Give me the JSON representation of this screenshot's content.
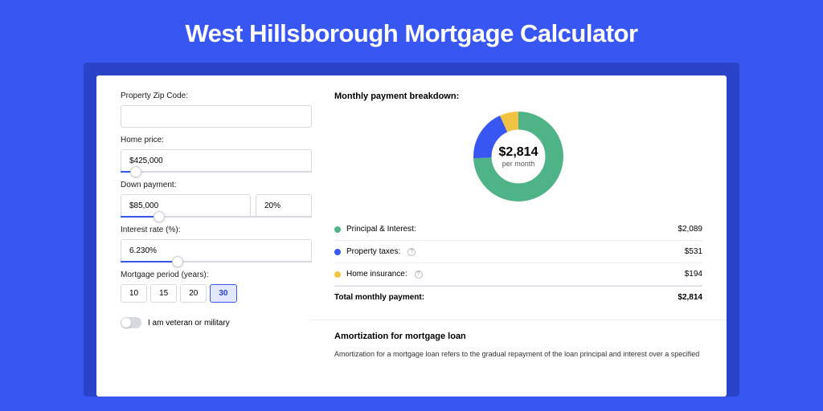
{
  "title": "West Hillsborough Mortgage Calculator",
  "form": {
    "zip": {
      "label": "Property Zip Code:",
      "value": ""
    },
    "home_price": {
      "label": "Home price:",
      "value": "$425,000",
      "slider_pct": 8
    },
    "down_payment": {
      "label": "Down payment:",
      "value": "$85,000",
      "pct": "20%",
      "slider_pct": 20
    },
    "interest": {
      "label": "Interest rate (%):",
      "value": "6.230%",
      "slider_pct": 30
    },
    "period": {
      "label": "Mortgage period (years):",
      "options": [
        "10",
        "15",
        "20",
        "30"
      ],
      "selected": "30"
    },
    "veteran": {
      "label": "I am veteran or military",
      "checked": false
    }
  },
  "breakdown": {
    "title": "Monthly payment breakdown:",
    "total": "$2,814",
    "per_text": "per month",
    "items": [
      {
        "label": "Principal & Interest:",
        "value": "$2,089",
        "color": "#4fb388",
        "info": false
      },
      {
        "label": "Property taxes:",
        "value": "$531",
        "color": "#3857f2",
        "info": true
      },
      {
        "label": "Home insurance:",
        "value": "$194",
        "color": "#f2c343",
        "info": true
      }
    ],
    "total_row": {
      "label": "Total monthly payment:",
      "value": "$2,814"
    }
  },
  "chart_data": {
    "type": "pie",
    "title": "Monthly payment breakdown",
    "series": [
      {
        "name": "Principal & Interest",
        "value": 2089,
        "color": "#4fb388"
      },
      {
        "name": "Property taxes",
        "value": 531,
        "color": "#3857f2"
      },
      {
        "name": "Home insurance",
        "value": 194,
        "color": "#f2c343"
      }
    ],
    "total": 2814,
    "center_label": "$2,814",
    "center_sub": "per month"
  },
  "amortization": {
    "title": "Amortization for mortgage loan",
    "text": "Amortization for a mortgage loan refers to the gradual repayment of the loan principal and interest over a specified"
  }
}
